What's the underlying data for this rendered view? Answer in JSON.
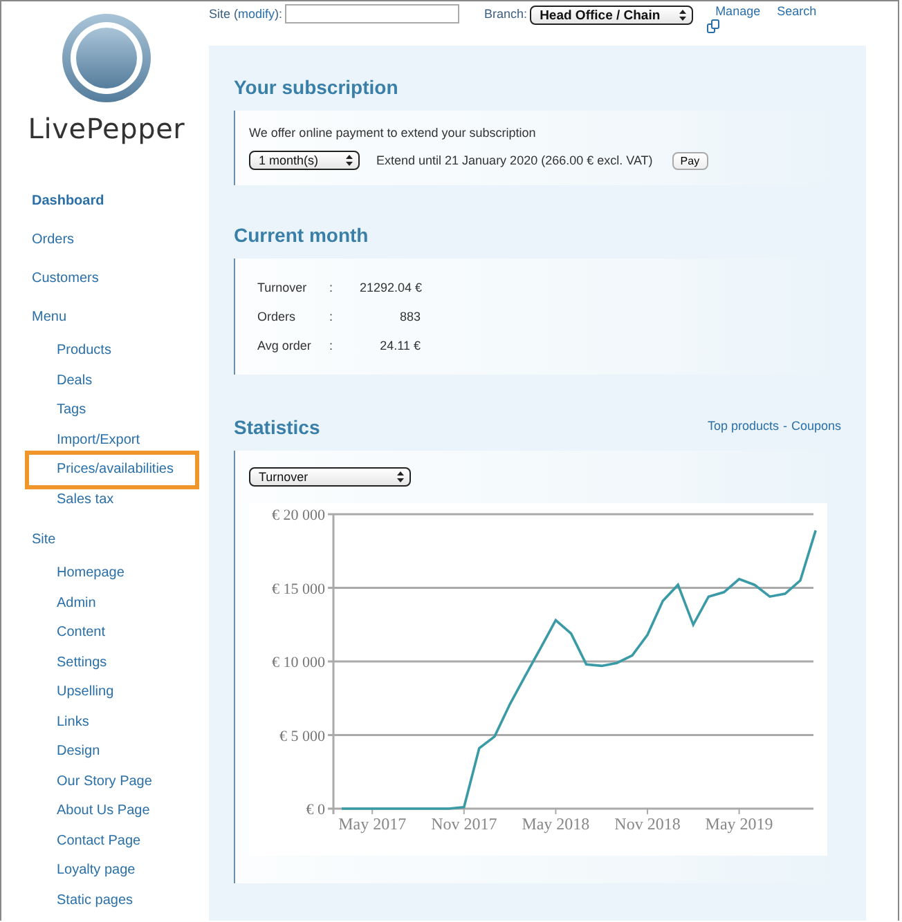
{
  "logo": {
    "text": "LivePepper"
  },
  "topbar": {
    "site_prefix": "Site (",
    "modify_link": "modify",
    "site_suffix": "):",
    "branch_label": "Branch:",
    "branch_value": "Head Office / Chain",
    "manage_link": "Manage",
    "search_link": "Search"
  },
  "sidebar": {
    "items": [
      {
        "label": "Dashboard",
        "selected": true,
        "highlighted": false
      },
      {
        "label": "Orders",
        "selected": false,
        "highlighted": false
      },
      {
        "label": "Customers",
        "selected": false,
        "highlighted": false
      },
      {
        "label": "Menu",
        "selected": false,
        "highlighted": false,
        "children": [
          {
            "label": "Products",
            "selected": false,
            "highlighted": false
          },
          {
            "label": "Deals",
            "selected": false,
            "highlighted": false
          },
          {
            "label": "Tags",
            "selected": false,
            "highlighted": false
          },
          {
            "label": "Import/Export",
            "selected": false,
            "highlighted": false
          },
          {
            "label": "Prices/availabilities",
            "selected": false,
            "highlighted": true
          },
          {
            "label": "Sales tax",
            "selected": false,
            "highlighted": false
          }
        ]
      },
      {
        "label": "Site",
        "selected": false,
        "highlighted": false,
        "children": [
          {
            "label": "Homepage",
            "selected": false,
            "highlighted": false
          },
          {
            "label": "Admin",
            "selected": false,
            "highlighted": false
          },
          {
            "label": "Content",
            "selected": false,
            "highlighted": false
          },
          {
            "label": "Settings",
            "selected": false,
            "highlighted": false
          },
          {
            "label": "Upselling",
            "selected": false,
            "highlighted": false
          },
          {
            "label": "Links",
            "selected": false,
            "highlighted": false
          },
          {
            "label": "Design",
            "selected": false,
            "highlighted": false
          },
          {
            "label": "Our Story Page",
            "selected": false,
            "highlighted": false
          },
          {
            "label": "About Us Page",
            "selected": false,
            "highlighted": false
          },
          {
            "label": "Contact Page",
            "selected": false,
            "highlighted": false
          },
          {
            "label": "Loyalty page",
            "selected": false,
            "highlighted": false
          },
          {
            "label": "Static pages",
            "selected": false,
            "highlighted": false
          }
        ]
      }
    ]
  },
  "subscription": {
    "title": "Your subscription",
    "intro": "We offer online payment to extend your subscription",
    "duration_value": "1 month(s)",
    "extend_text": "Extend until 21 January 2020 (266.00 € excl. VAT)",
    "pay_button": "Pay"
  },
  "current_month": {
    "title": "Current month",
    "rows": [
      {
        "label": "Turnover",
        "separator": ":",
        "value": "21292.04 €"
      },
      {
        "label": "Orders",
        "separator": ":",
        "value": "883"
      },
      {
        "label": "Avg order",
        "separator": ":",
        "value": "24.11 €"
      }
    ]
  },
  "statistics": {
    "title": "Statistics",
    "top_products_link": "Top products",
    "link_separator": "-",
    "coupons_link": "Coupons",
    "metric_value": "Turnover",
    "chart_data": {
      "type": "line",
      "categories": [
        null,
        null,
        "May 2017",
        null,
        null,
        null,
        null,
        null,
        "Nov 2017",
        null,
        null,
        null,
        null,
        null,
        "May 2018",
        null,
        null,
        null,
        null,
        null,
        "Nov 2018",
        null,
        null,
        null,
        null,
        null,
        "May 2019",
        null,
        null,
        null,
        null,
        null
      ],
      "series": [
        {
          "color": "#3a9aa6",
          "values": [
            0,
            0,
            0,
            0,
            0,
            0,
            0,
            0,
            100,
            4100,
            4900,
            7100,
            9000,
            10900,
            12800,
            11900,
            9800,
            9700,
            9900,
            10400,
            11800,
            14100,
            15200,
            12500,
            14400,
            14700,
            15600,
            15200,
            14400,
            14600,
            15500,
            18900
          ]
        }
      ],
      "ylim": [
        0,
        20000
      ],
      "grid": true,
      "yticks": [
        {
          "value": 0,
          "label": "€ 0"
        },
        {
          "value": 5000,
          "label": "€ 5 000"
        },
        {
          "value": 10000,
          "label": "€ 10 000"
        },
        {
          "value": 15000,
          "label": "€ 15 000"
        },
        {
          "value": 20000,
          "label": "€ 20 000"
        }
      ]
    }
  }
}
